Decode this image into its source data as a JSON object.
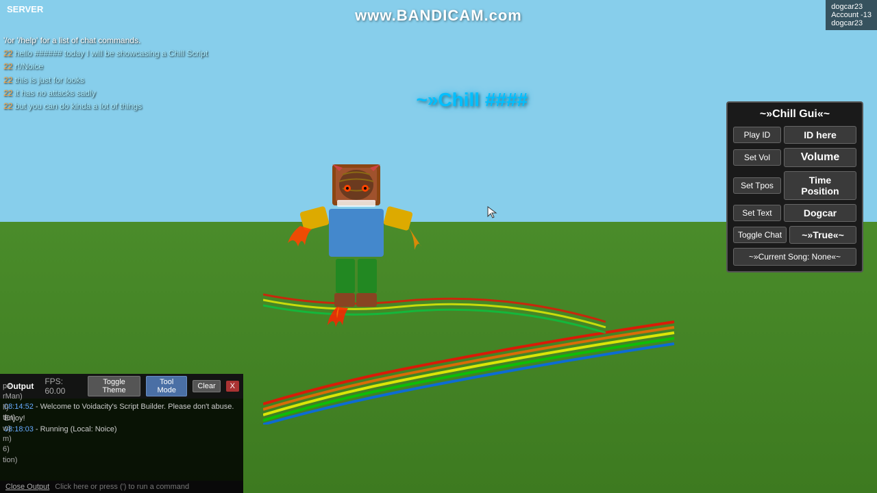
{
  "bandicam": {
    "watermark": "www.BANDICAM.com"
  },
  "user_info": {
    "username": "dogcar23",
    "account_label": "Account -13",
    "display_name": "dogcar23"
  },
  "server": {
    "label": "SERVER"
  },
  "chat": {
    "messages": [
      {
        "prefix": "",
        "text": "'/or '/help' for a list of chat commands."
      },
      {
        "prefix": "",
        "text": "hello ###### today I will be showcasing a Chill Script"
      },
      {
        "prefix": "",
        "text": "r!/Noice"
      },
      {
        "prefix": "",
        "text": "this is just for looks"
      },
      {
        "prefix": "",
        "text": "it has no attacks sadly"
      },
      {
        "prefix": "",
        "text": "but you can do kinda a lot of things"
      }
    ]
  },
  "floating_title": {
    "text": "~»Chill  ####"
  },
  "gui": {
    "title": "~»Chill Gui«~",
    "play_id_label": "Play ID",
    "play_id_value": "ID here",
    "set_vol_label": "Set Vol",
    "set_vol_value": "Volume",
    "set_tpos_label": "Set Tpos",
    "set_tpos_value": "Time Position",
    "set_text_label": "Set Text",
    "set_text_value": "Dogcar",
    "toggle_chat_label": "Toggle Chat",
    "toggle_chat_value": "~»True«~",
    "current_song_label": "~»Current Song: None«~"
  },
  "output": {
    "tab_label": "Output",
    "fps_label": "FPS: 60.00",
    "toggle_theme_label": "Toggle Theme",
    "tool_mode_label": "Tool Mode",
    "clear_label": "Clear",
    "close_x_label": "X",
    "messages": [
      {
        "time": "08:14:52",
        "text": " - Welcome to Voidacity's Script Builder. Please don't abuse. Enjoy!"
      },
      {
        "time": "08:18:03",
        "text": " - Running (Local: Noice)"
      }
    ],
    "footer_close": "Close Output",
    "footer_run": "Click here or press (') to run a command"
  },
  "left_sidebar": {
    "items": [
      "ps",
      "rMan)",
      "ll)",
      "tlet)",
      "w)",
      "m)",
      "6)",
      "tion)"
    ]
  }
}
